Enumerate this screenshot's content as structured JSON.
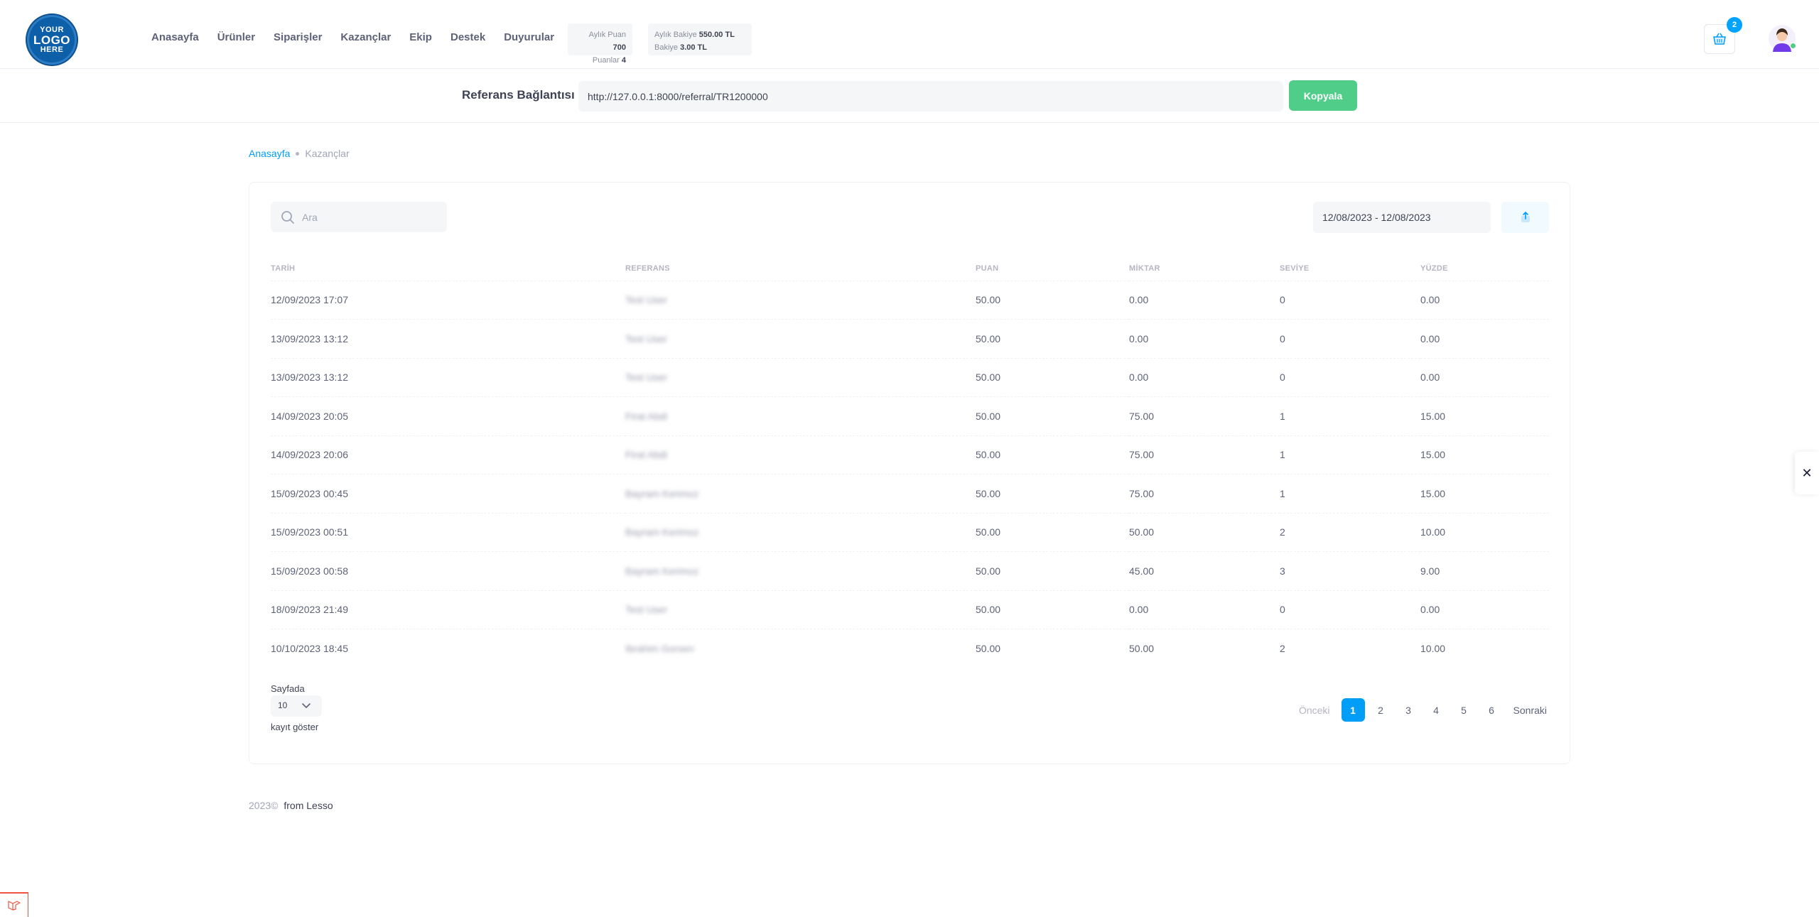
{
  "logo": {
    "line1": "YOUR",
    "line2": "LOGO",
    "line3": "HERE"
  },
  "nav": [
    "Anasayfa",
    "Ürünler",
    "Siparişler",
    "Kazançlar",
    "Ekip",
    "Destek",
    "Duyurular"
  ],
  "stats": {
    "monthly_points_label": "Aylık Puan",
    "monthly_points_value": "700",
    "points_label": "Puanlar",
    "points_value": "4",
    "monthly_balance_label": "Aylık Bakiye",
    "monthly_balance_value": "550.00 TL",
    "balance_label": "Bakiye",
    "balance_value": "3.00 TL"
  },
  "cart": {
    "count": "2",
    "icon": "basket-icon"
  },
  "referral": {
    "label": "Referans Bağlantısı",
    "url": "http://127.0.0.1:8000/referral/TR1200000",
    "copy_label": "Kopyala"
  },
  "breadcrumb": {
    "home": "Anasayfa",
    "current": "Kazançlar"
  },
  "search": {
    "placeholder": "Ara"
  },
  "date_range": "12/08/2023 - 12/08/2023",
  "table": {
    "headers": [
      "TARİH",
      "REFERANS",
      "PUAN",
      "MİKTAR",
      "SEVİYE",
      "YÜZDE"
    ],
    "rows": [
      [
        "12/09/2023 17:07",
        "Test User",
        "50.00",
        "0.00",
        "0",
        "0.00"
      ],
      [
        "13/09/2023 13:12",
        "Test User",
        "50.00",
        "0.00",
        "0",
        "0.00"
      ],
      [
        "13/09/2023 13:12",
        "Test User",
        "50.00",
        "0.00",
        "0",
        "0.00"
      ],
      [
        "14/09/2023 20:05",
        "Firat Abdi",
        "50.00",
        "75.00",
        "1",
        "15.00"
      ],
      [
        "14/09/2023 20:06",
        "Firat Abdi",
        "50.00",
        "75.00",
        "1",
        "15.00"
      ],
      [
        "15/09/2023 00:45",
        "Bayram Kerimoz",
        "50.00",
        "75.00",
        "1",
        "15.00"
      ],
      [
        "15/09/2023 00:51",
        "Bayram Kerimoz",
        "50.00",
        "50.00",
        "2",
        "10.00"
      ],
      [
        "15/09/2023 00:58",
        "Bayram Kerimoz",
        "50.00",
        "45.00",
        "3",
        "9.00"
      ],
      [
        "18/09/2023 21:49",
        "Test User",
        "50.00",
        "0.00",
        "0",
        "0.00"
      ],
      [
        "10/10/2023 18:45",
        "Ibrahim Gorsen",
        "50.00",
        "50.00",
        "2",
        "10.00"
      ]
    ]
  },
  "per_page": {
    "label_top": "Sayfada",
    "value": "10",
    "label_bottom": "kayıt göster"
  },
  "pagination": {
    "prev": "Önceki",
    "pages": [
      "1",
      "2",
      "3",
      "4",
      "5",
      "6"
    ],
    "active": "1",
    "next": "Sonraki"
  },
  "footer": {
    "year": "2023©",
    "from": "from Lesso"
  },
  "colors": {
    "primary": "#009ef7",
    "success": "#50cd89",
    "logo": "#0d5fa8"
  }
}
